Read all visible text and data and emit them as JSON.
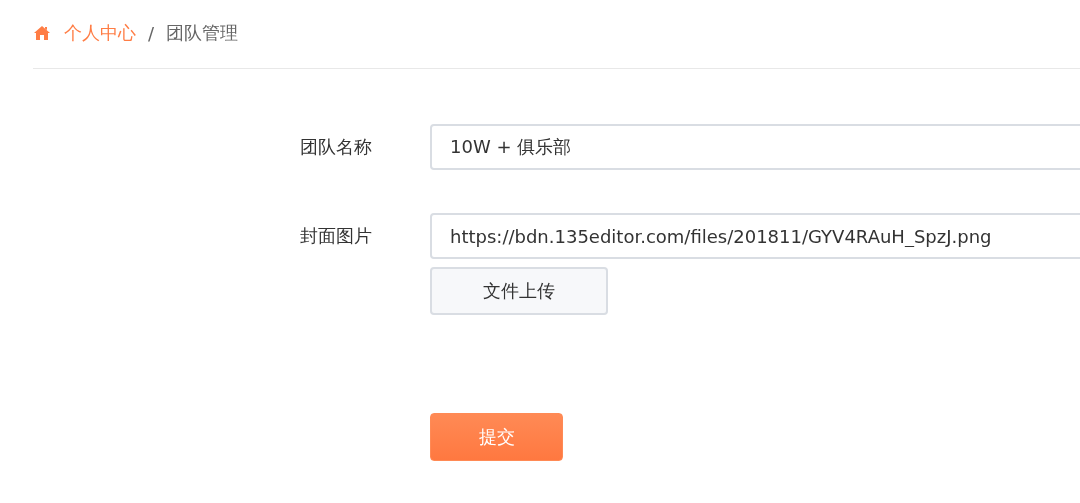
{
  "breadcrumb_separator": "/",
  "breadcrumb": [
    {
      "label": "个人中心",
      "link": true
    },
    {
      "label": "团队管理",
      "link": false
    }
  ],
  "fields": [
    {
      "label": "团队名称",
      "value": "10W + 俱乐部"
    },
    {
      "label": "封面图片",
      "value": "https://bdn.135editor.com/files/201811/GYV4RAuH_SpzJ.png",
      "upload_button": "文件上传"
    }
  ],
  "submit": "提交"
}
